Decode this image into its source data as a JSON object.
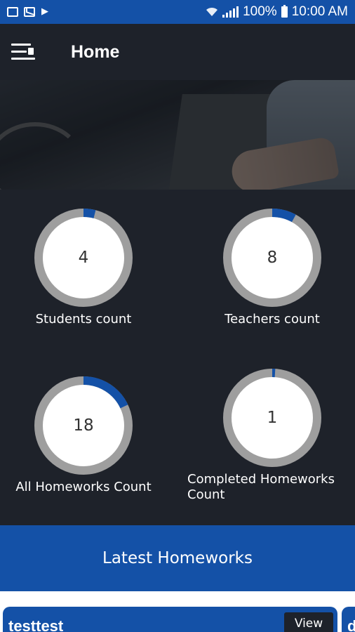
{
  "status_bar": {
    "battery": "100%",
    "time": "10:00 AM",
    "icons": [
      "image-icon",
      "mail-icon",
      "flag-icon",
      "wifi-icon",
      "signal-icon",
      "battery-icon"
    ]
  },
  "header": {
    "title": "Home",
    "menu_icon": "menu-open-icon"
  },
  "colors": {
    "primary": "#1451a7",
    "background": "#1e222a",
    "ring_track": "#9e9e9e",
    "ring_fill": "#ffffff"
  },
  "stats": [
    {
      "value": "4",
      "label": "Students count",
      "progress": 0.04
    },
    {
      "value": "8",
      "label": "Teachers count",
      "progress": 0.08
    },
    {
      "value": "18",
      "label": "All Homeworks Count",
      "progress": 0.18
    },
    {
      "value": "1",
      "label": "Completed Homeworks Count",
      "progress": 0.01
    }
  ],
  "latest": {
    "heading": "Latest Homeworks",
    "items": [
      {
        "title": "testtest",
        "action": "View"
      },
      {
        "title": "d"
      }
    ]
  }
}
